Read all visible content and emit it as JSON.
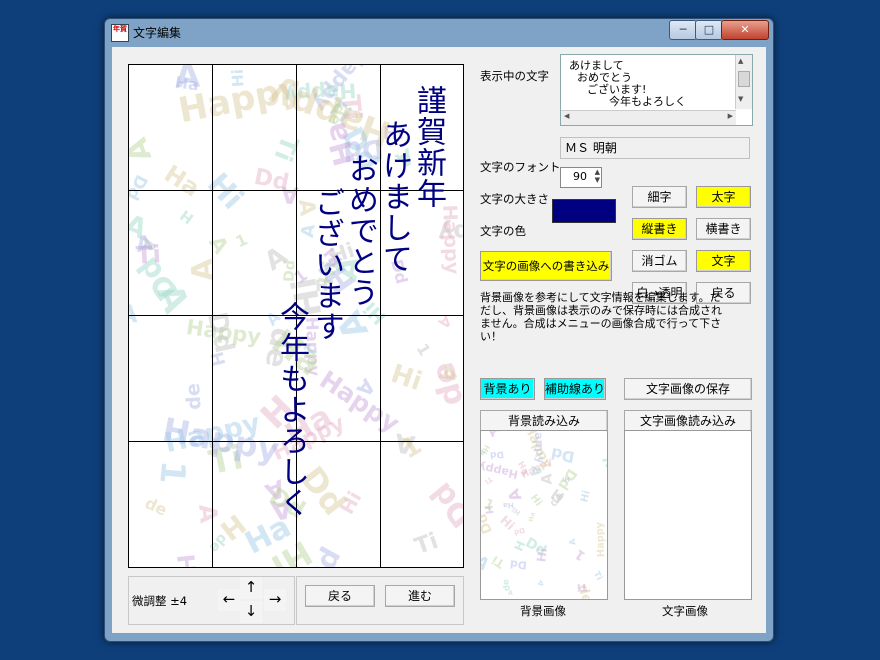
{
  "window": {
    "title": "文字編集",
    "min": "─",
    "max": "□",
    "close": "✕",
    "icon_text": "年賀"
  },
  "canvas": {
    "columns": [
      "謹賀新年",
      "あけまして",
      "おめでとう",
      "ございます",
      "今年もよろしく"
    ],
    "text_color": "#000080",
    "bg_fragments": [
      "Happy",
      "A",
      "Hi",
      "Ti",
      "Dd",
      "Happy",
      "A",
      "de",
      "H",
      "A",
      "1",
      "A",
      "Hi",
      "Ha",
      "Dd"
    ]
  },
  "labels": {
    "display_text": "表示中の文字",
    "font": "文字のフォント",
    "size": "文字の大きさ",
    "color": "文字の色",
    "fine_adjust": "微調整 ±4",
    "bg_image": "背景画像",
    "text_image": "文字画像"
  },
  "display_text_lines": [
    "あけまして",
    "おめでとう",
    "ございます!",
    "今年もよろしく"
  ],
  "font_value": "ＭＳ 明朝",
  "size_value": "90",
  "color_value": "#000080",
  "buttons": {
    "thin": "細字",
    "bold": "太字",
    "vertical": "縦書き",
    "horizontal": "横書き",
    "write_image": "文字の画像への書き込み",
    "eraser": "消ゴム",
    "text": "文字",
    "white_transparent": "白→透明",
    "back": "戻る",
    "bg_on": "背景あり",
    "guide_on": "補助線あり",
    "save_text_image": "文字画像の保存",
    "load_bg": "背景読み込み",
    "load_text_image": "文字画像読み込み",
    "undo": "戻る",
    "redo": "進む"
  },
  "arrows": {
    "up": "↑",
    "down": "↓",
    "left": "←",
    "right": "→"
  },
  "description": "背景画像を参考にして文字情報を編集します。ただし、背景画像は表示のみで保存時には合成されません。合成はメニューの画像合成で行って下さい！"
}
